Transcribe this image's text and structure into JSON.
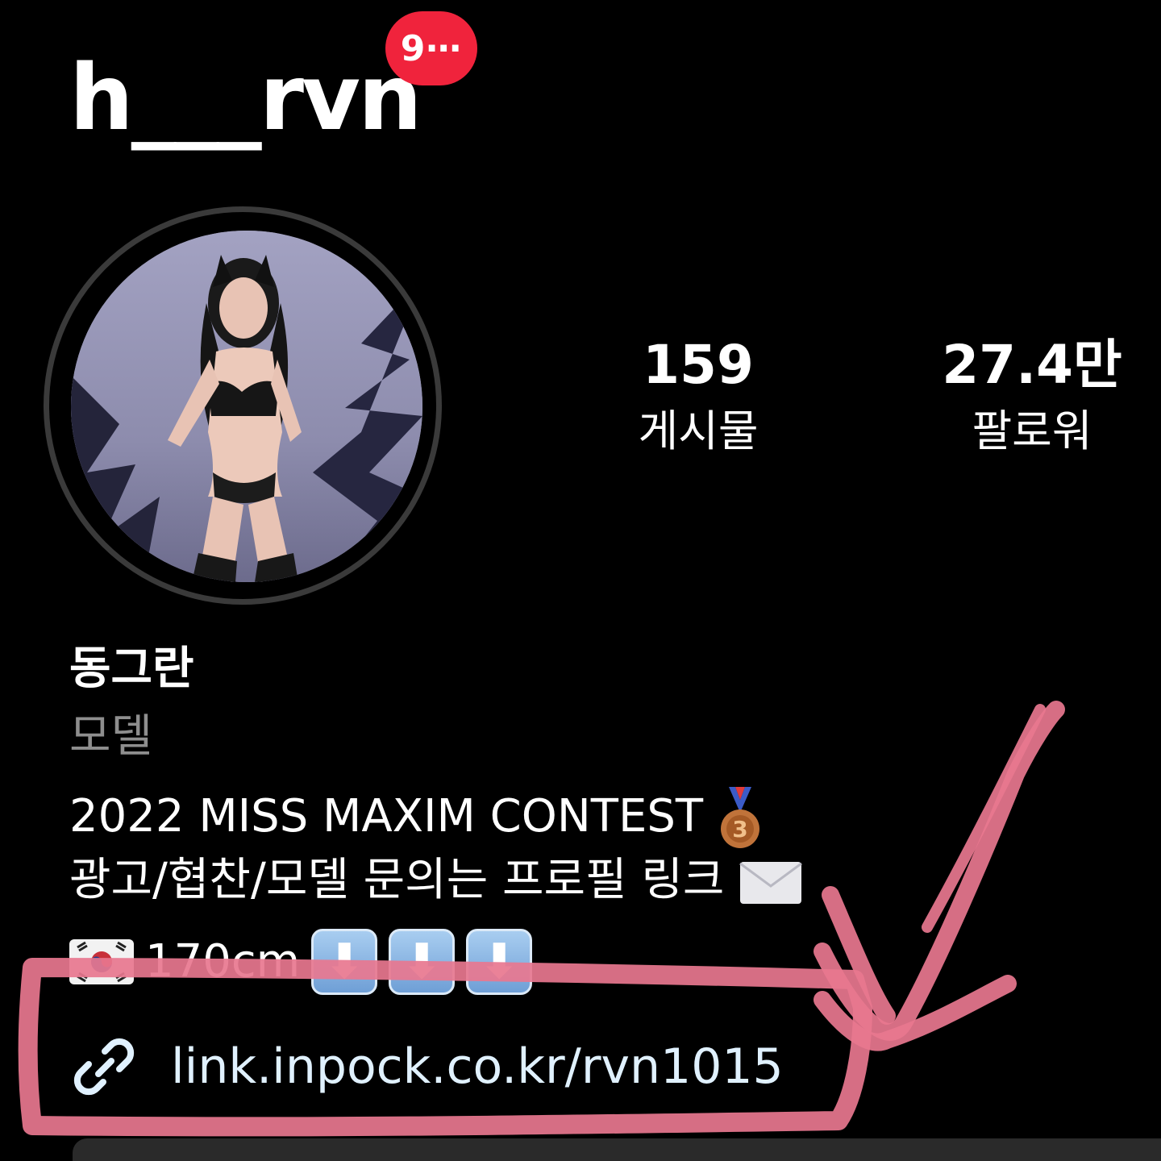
{
  "header": {
    "username": "h___rvn",
    "notification_badge": "9⋯"
  },
  "stats": {
    "posts": {
      "value": "159",
      "label": "게시물"
    },
    "followers": {
      "value": "27.4만",
      "label": "팔로워"
    }
  },
  "profile": {
    "display_name": "동그란",
    "category": "모델",
    "bio_line1": "2022 MISS MAXIM CONTEST",
    "bio_line1_emoji": "third-place-medal-icon",
    "bio_line2": "광고/협찬/모델 문의는 프로필 링크",
    "bio_line2_emoji": "envelope-icon",
    "bio_line3": "170cm",
    "bio_line3_emojis": [
      "south-korea-flag-icon",
      "down-arrow-icon",
      "down-arrow-icon",
      "down-arrow-icon"
    ]
  },
  "link": {
    "icon": "link-icon",
    "url": "link.inpock.co.kr/rvn1015"
  },
  "colors": {
    "background": "#000000",
    "badge": "#f0233c",
    "annotation": "#e8778f",
    "link_text": "#e0f1ff",
    "category_text": "#8e8e8e"
  }
}
